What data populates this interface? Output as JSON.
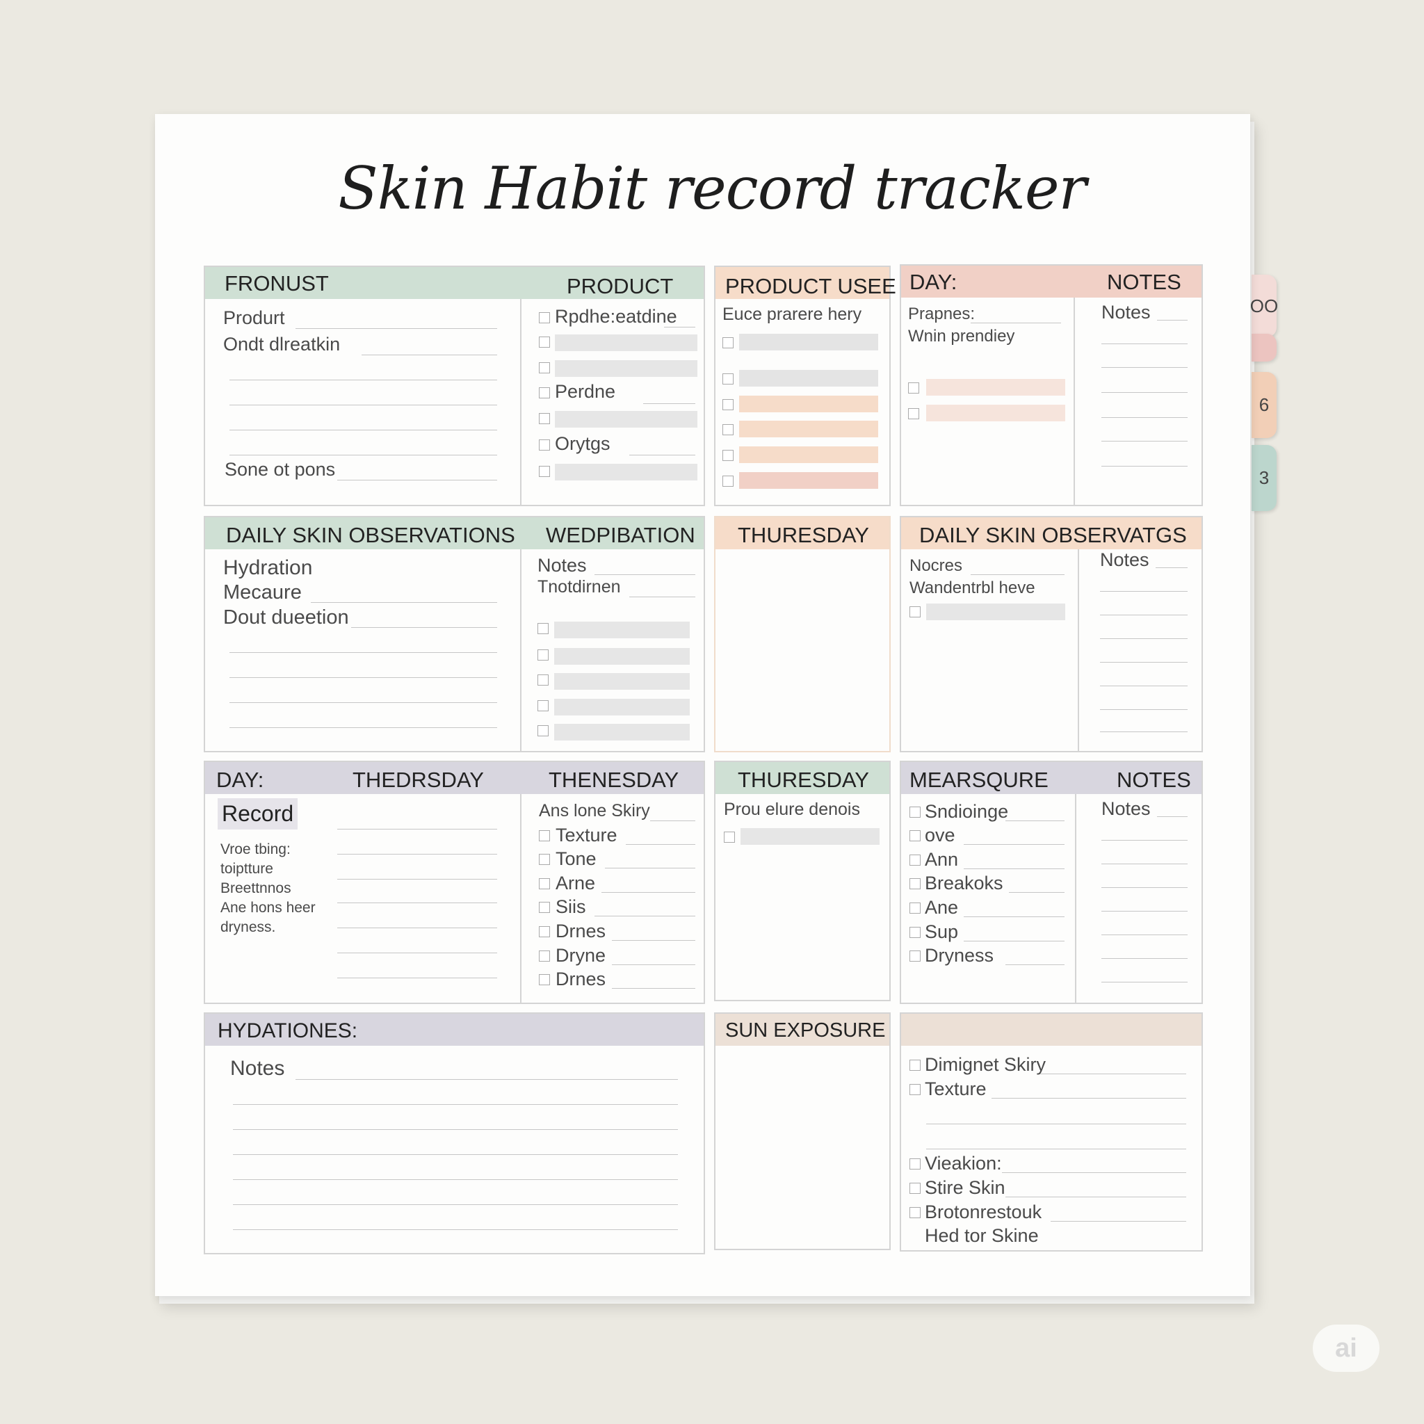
{
  "title": "Skin Habit record tracker",
  "tabs": [
    "OO",
    "",
    "6",
    "3"
  ],
  "watermark": "ai",
  "colors": {
    "green": "#cfe0d4",
    "peach": "#f6dcc9",
    "rose": "#f1d0c6",
    "lavender": "#d8d6df",
    "sand": "#ece0d6",
    "gray_bar": "#e6e6e6"
  },
  "s1": {
    "h1": "FRONUST",
    "h2": "PRODUCT",
    "l1": "Produrt",
    "l2": "Ondt dlreatkin",
    "l3": "Sone ot pons",
    "r1": "Rpdhe:eatdine",
    "r2": "Perdne",
    "r3": "Orytgs"
  },
  "s2": {
    "h": "PRODUCT USEE",
    "l1": "Euce prarere hery"
  },
  "s3": {
    "h1": "DAY:",
    "h2": "NOTES",
    "l1": "Prapnes:",
    "l2": "Wnin prendiey",
    "n": "Notes"
  },
  "s4": {
    "h1": "DAILY SKIN OBSERVATIONS",
    "h2": "WEDPIBATION",
    "l1": "Hydration",
    "l2": "Mecaure",
    "l3": "Dout dueetion",
    "r1": "Notes",
    "r2": "Tnotdirnen"
  },
  "s5": {
    "h": "THURESDAY"
  },
  "s6": {
    "h": "DAILY SKIN OBSERVATGS",
    "l1": "Nocres",
    "l2": "Wandentrbl heve",
    "n": "Notes"
  },
  "s7": {
    "h1": "DAY:",
    "h2": "THEDRSDAY",
    "h3": "THENESDAY",
    "rec": "Record",
    "p1": "Vroe tbing:",
    "p2": "toiptture",
    "p3": "Breettnnos",
    "p4": "Ane hons heer",
    "p5": "dryness.",
    "r0": "Ans lone Skiry",
    "items": [
      "Texture",
      "Tone",
      "Arne",
      "Siis",
      "Drnes",
      "Dryne",
      "Drnes"
    ]
  },
  "s8": {
    "h": "THURESDAY",
    "l1": "Prou elure denois"
  },
  "s9": {
    "h1": "MEARSQURE",
    "h2": "NOTES",
    "n": "Notes",
    "items": [
      "Sndioinge",
      "ove",
      "Ann",
      "Breakoks",
      "Ane",
      "Sup",
      "Dryness"
    ]
  },
  "s10": {
    "h": "HYDATIONES:",
    "n": "Notes"
  },
  "s11": {
    "h": "SUN EXPOSURE"
  },
  "s12": {
    "items": [
      "Dimignet Skiry",
      "Texture",
      "Vieakion:",
      "Stire Skin",
      "Brotonrestouk"
    ],
    "last": "Hed tor Skine"
  }
}
